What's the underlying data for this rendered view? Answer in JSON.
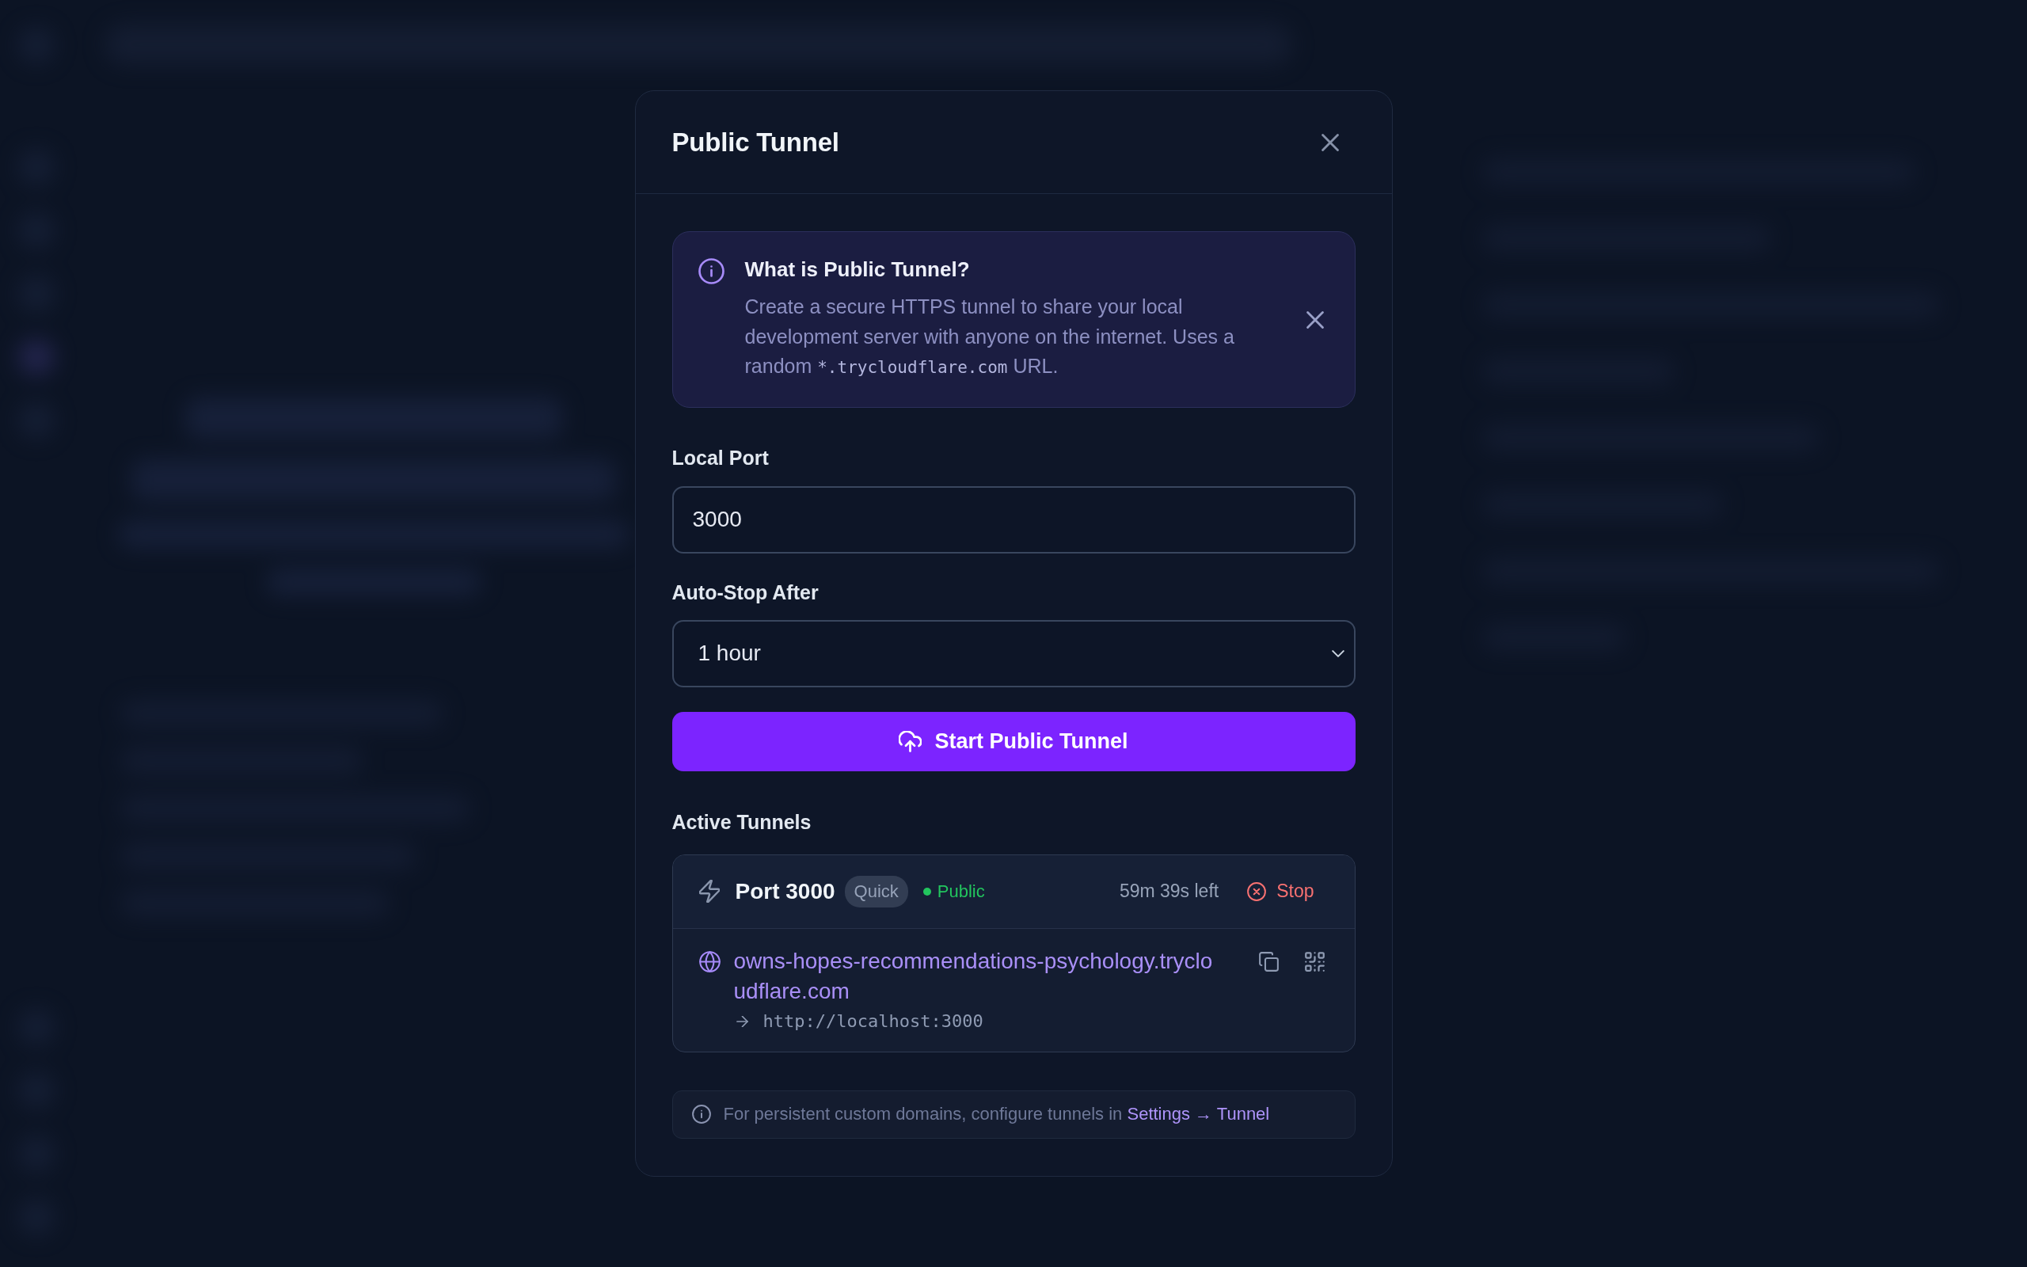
{
  "dialog": {
    "title": "Public Tunnel",
    "info_banner": {
      "title": "What is Public Tunnel?",
      "text_parts": [
        {
          "kind": "plain",
          "text": "Create a secure HTTPS tunnel to share your local development server with anyone on the internet. Uses a random "
        },
        {
          "kind": "code",
          "text": "*.trycloudflare.com"
        },
        {
          "kind": "plain",
          "text": " URL."
        }
      ]
    },
    "fields": [
      {
        "kind": "input",
        "label": "Local Port",
        "value": "3000"
      },
      {
        "kind": "select",
        "label": "Auto-Stop After",
        "value": "1 hour"
      }
    ],
    "start_button": {
      "label": "Start Public Tunnel"
    },
    "active_tunnels": {
      "heading": "Active Tunnels",
      "tunnels": [
        {
          "name": "Port 3000",
          "type": "Quick",
          "status": {
            "label": "Public",
            "color": "#22c55e"
          },
          "time_left": "59m 39s left",
          "stop_label": "Stop",
          "url": "owns-hopes-recommendations-psychology.trycloudflare.com",
          "target": "http://localhost:3000"
        }
      ]
    },
    "footer_note": {
      "text": "For persistent custom domains, configure tunnels in",
      "link": "Settings → Tunnel"
    }
  }
}
